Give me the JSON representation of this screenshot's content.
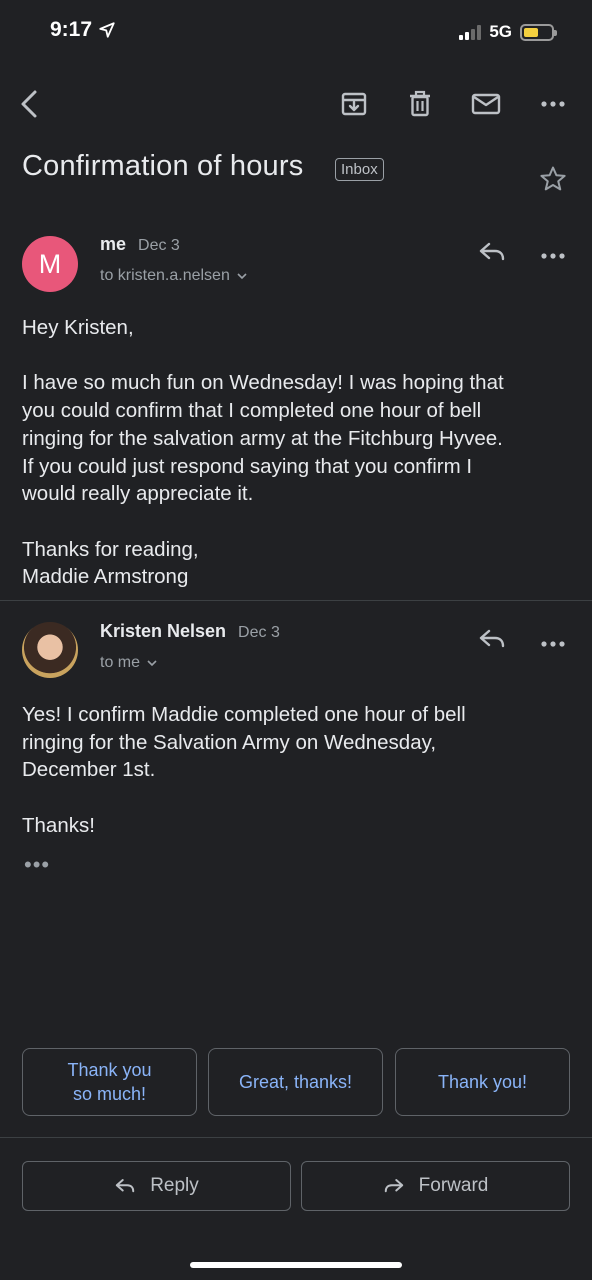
{
  "status_bar": {
    "time": "9:17",
    "network": "5G"
  },
  "toolbar": {
    "back": "back-arrow-icon",
    "archive": "archive-icon",
    "delete": "trash-icon",
    "mark_unread": "mail-icon",
    "more": "more-horizontal-icon"
  },
  "email": {
    "subject": "Confirmation of hours",
    "label": "Inbox"
  },
  "messages": [
    {
      "avatar_letter": "M",
      "avatar_color": "#e8577a",
      "sender": "me",
      "date": "Dec 3",
      "to": "to kristen.a.nelsen",
      "greeting": "Hey Kristen,",
      "body_lines": [
        "I have so much fun on Wednesday! I was hoping that",
        "you could confirm that I completed one hour of bell",
        "ringing for the salvation army at the Fitchburg Hyvee.",
        "If you could just respond saying that you confirm I",
        "would really appreciate it."
      ],
      "signoff": "Thanks for reading,",
      "signature": "Maddie Armstrong"
    },
    {
      "sender": "Kristen Nelsen",
      "date": "Dec 3",
      "to": "to me",
      "body_lines": [
        "Yes! I confirm Maddie completed one hour of bell",
        "ringing for the Salvation Army on Wednesday,",
        "December 1st."
      ],
      "signoff": "Thanks!",
      "trimmed": "•••"
    }
  ],
  "smart_replies": [
    {
      "line1": "Thank you",
      "line2": "so much!"
    },
    {
      "line1": "Great, thanks!"
    },
    {
      "line1": "Thank you!"
    }
  ],
  "actions": {
    "reply": "Reply",
    "forward": "Forward"
  },
  "colors": {
    "background": "#202124",
    "accent": "#8ab4f8"
  }
}
